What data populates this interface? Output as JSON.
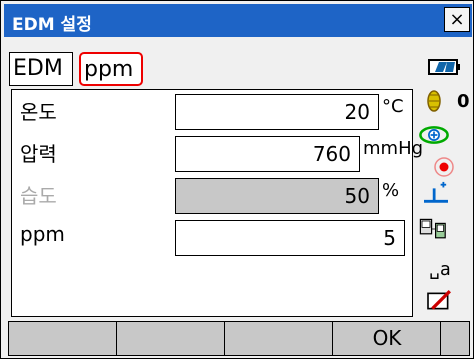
{
  "window": {
    "title": "EDM 설정",
    "close_label": "×"
  },
  "tabs": [
    {
      "label": "EDM"
    },
    {
      "label": "ppm"
    }
  ],
  "fields": [
    {
      "label": "온도",
      "value": "20",
      "unit": "°C"
    },
    {
      "label": "압력",
      "value": "760",
      "unit": "mmHg"
    },
    {
      "label": "습도",
      "value": "50",
      "unit": "%"
    },
    {
      "label": "ppm",
      "value": "5",
      "unit": ""
    }
  ],
  "side_panel": {
    "count": "0"
  },
  "function_keys": {
    "f1": "",
    "f2": "",
    "f3": "",
    "f4": "OK"
  }
}
